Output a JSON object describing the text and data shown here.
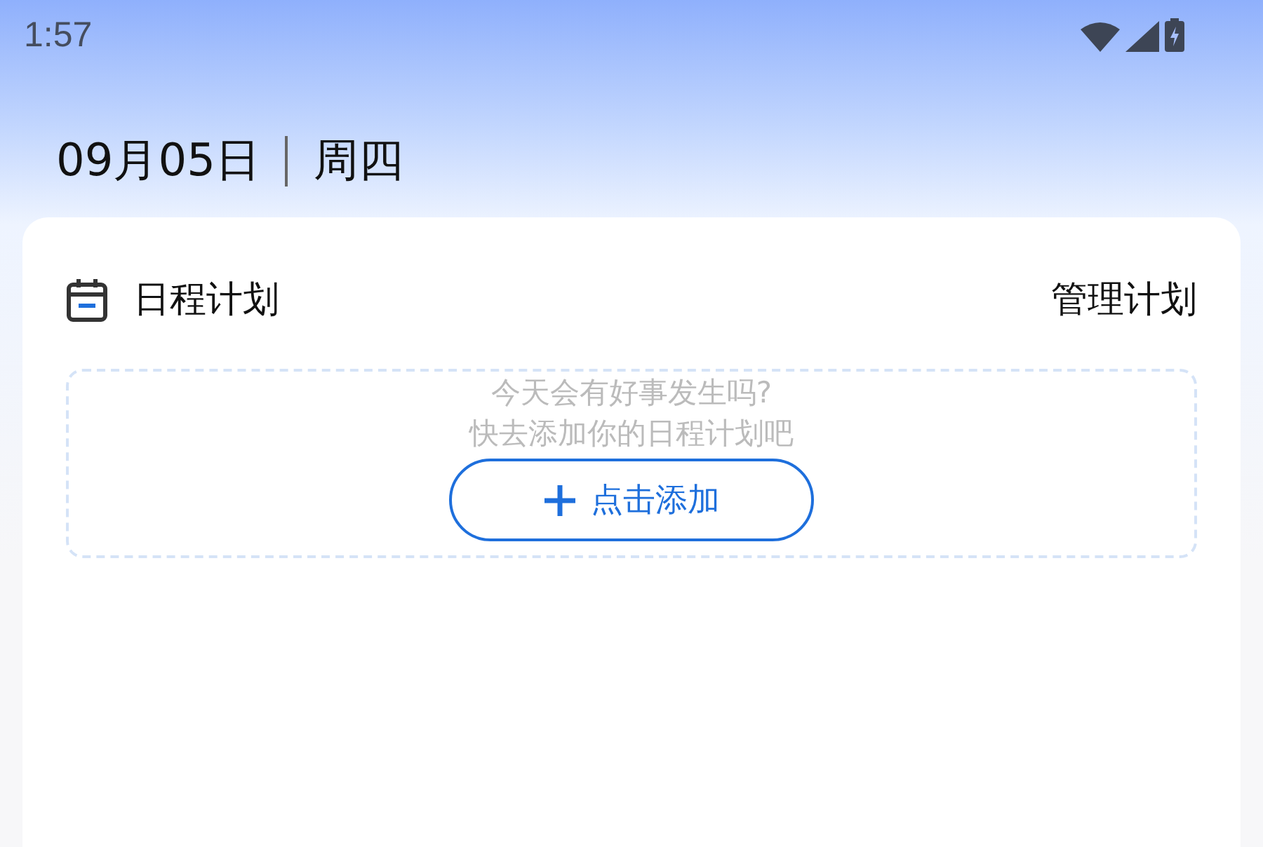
{
  "status_bar": {
    "time": "1:57"
  },
  "date": {
    "day": "09月05日",
    "weekday": "周四"
  },
  "schedule_card": {
    "title": "日程计划",
    "manage_link": "管理计划",
    "empty_state": {
      "lines": [
        "今天会有好事发生吗?",
        "快去添加你的日程计划吧"
      ],
      "add_button": "点击添加"
    }
  }
}
